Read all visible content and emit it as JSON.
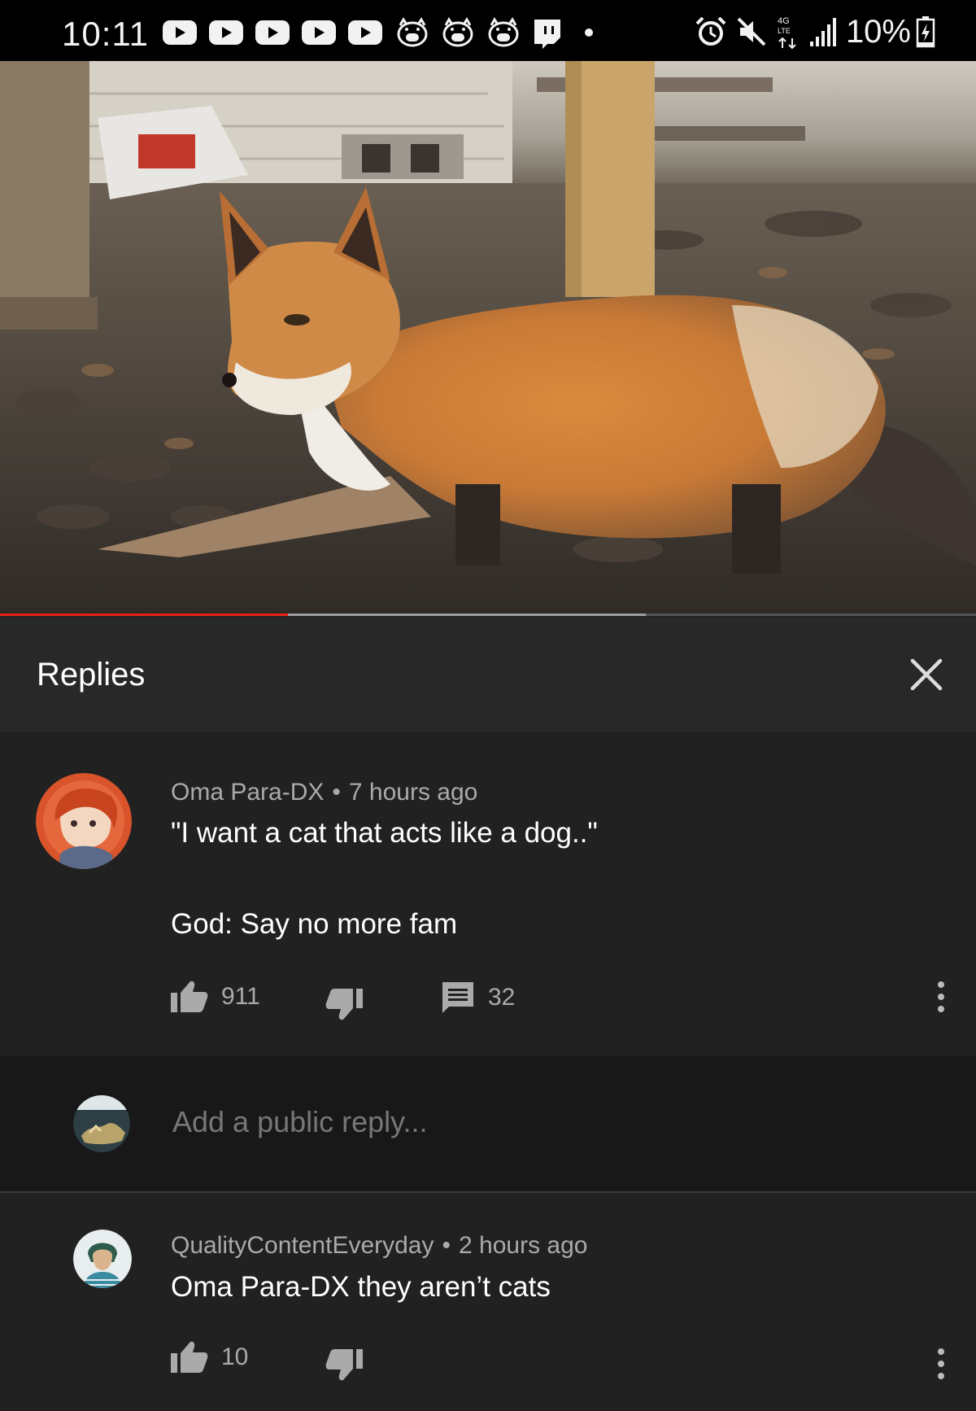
{
  "status_bar": {
    "time": "10:11",
    "notification_icons": [
      "youtube-icon",
      "youtube-icon",
      "youtube-icon",
      "youtube-icon",
      "youtube-icon",
      "pig-icon",
      "pig-icon",
      "pig-icon",
      "twitch-icon"
    ],
    "system_icons": [
      "alarm-icon",
      "mute-icon",
      "lte-icon",
      "signal-icon"
    ],
    "network_label": "4G",
    "battery": "10%"
  },
  "video": {
    "played_fraction": 0.295,
    "buffered_fraction": 0.662,
    "accent_color": "#e62117"
  },
  "replies_panel": {
    "title": "Replies"
  },
  "parent_comment": {
    "author": "Oma Para-DX",
    "separator": "•",
    "time": "7 hours ago",
    "text": "\"I want a cat that acts like a dog..\"\n\nGod: Say no more fam",
    "likes": "911",
    "replies": "32"
  },
  "reply_box": {
    "placeholder": "Add a public reply..."
  },
  "reply": {
    "author": "QualityContentEveryday",
    "separator": "•",
    "time": "2 hours ago",
    "text": "Oma Para-DX they aren’t cats",
    "likes": "10"
  }
}
